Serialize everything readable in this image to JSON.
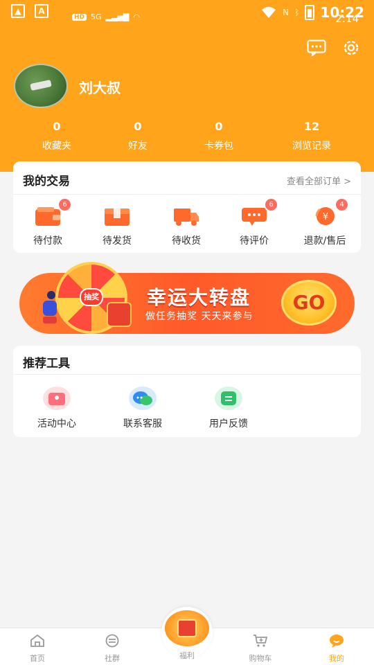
{
  "status_bar": {
    "time": "10:22",
    "secondary_time": "2:14",
    "network": "5G",
    "hd_label": "HD",
    "left_icons": [
      "gallery-icon",
      "app-icon"
    ],
    "right_icons": [
      "wifi-icon",
      "nfc-icon",
      "bluetooth-icon",
      "battery-icon"
    ]
  },
  "header": {
    "actions": [
      "message-icon",
      "settings-icon"
    ],
    "username": "刘大叔",
    "stats": [
      {
        "value": "0",
        "label": "收藏夹"
      },
      {
        "value": "0",
        "label": "好友"
      },
      {
        "value": "0",
        "label": "卡券包"
      },
      {
        "value": "12",
        "label": "浏览记录"
      }
    ]
  },
  "trade": {
    "title": "我的交易",
    "view_all": "查看全部订单 >",
    "orders": [
      {
        "label": "待付款",
        "badge": "6",
        "icon": "wallet-icon",
        "color": "#FF6A2C"
      },
      {
        "label": "待发货",
        "badge": "",
        "icon": "box-icon",
        "color": "#FF6A2C"
      },
      {
        "label": "待收货",
        "badge": "",
        "icon": "truck-icon",
        "color": "#FF6A2C"
      },
      {
        "label": "待评价",
        "badge": "6",
        "icon": "comment-icon",
        "color": "#FF6A2C"
      },
      {
        "label": "退款/售后",
        "badge": "4",
        "icon": "refund-icon",
        "color": "#FF6A2C"
      }
    ]
  },
  "banner": {
    "wheel_center": "抽奖",
    "title": "幸运大转盘",
    "subtitle": "做任务抽奖 天天来参与",
    "button": "GO"
  },
  "tools": {
    "title": "推荐工具",
    "items": [
      {
        "label": "活动中心",
        "icon": "activity-center-icon",
        "color": "#ff6f7b"
      },
      {
        "label": "联系客服",
        "icon": "customer-service-icon",
        "color": "#2f8cf0"
      },
      {
        "label": "用户反馈",
        "icon": "feedback-icon",
        "color": "#2fc06a"
      }
    ]
  },
  "tabbar": {
    "items": [
      {
        "label": "首页",
        "icon": "home-icon"
      },
      {
        "label": "社群",
        "icon": "community-icon"
      },
      {
        "label": "福利",
        "icon": "gift-icon"
      },
      {
        "label": "购物车",
        "icon": "cart-icon"
      },
      {
        "label": "我的",
        "icon": "profile-icon"
      }
    ],
    "active_color": "#FFA41B"
  },
  "colors": {
    "brand": "#FFA41B",
    "badge": "#FF6B5E"
  }
}
